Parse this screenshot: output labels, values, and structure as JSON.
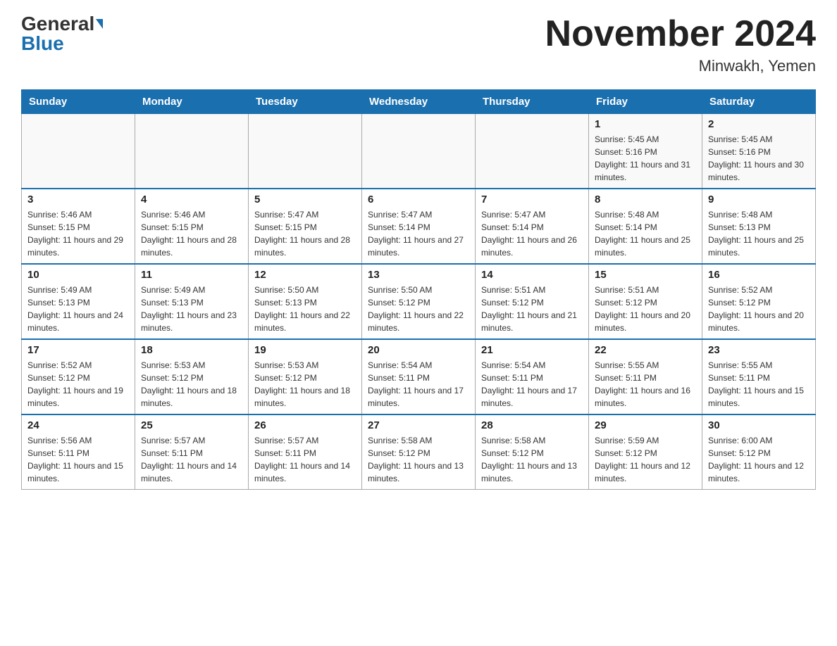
{
  "header": {
    "logo_general": "General",
    "logo_blue": "Blue",
    "month_title": "November 2024",
    "location": "Minwakh, Yemen"
  },
  "weekdays": [
    "Sunday",
    "Monday",
    "Tuesday",
    "Wednesday",
    "Thursday",
    "Friday",
    "Saturday"
  ],
  "weeks": [
    [
      {
        "day": "",
        "info": ""
      },
      {
        "day": "",
        "info": ""
      },
      {
        "day": "",
        "info": ""
      },
      {
        "day": "",
        "info": ""
      },
      {
        "day": "",
        "info": ""
      },
      {
        "day": "1",
        "info": "Sunrise: 5:45 AM\nSunset: 5:16 PM\nDaylight: 11 hours and 31 minutes."
      },
      {
        "day": "2",
        "info": "Sunrise: 5:45 AM\nSunset: 5:16 PM\nDaylight: 11 hours and 30 minutes."
      }
    ],
    [
      {
        "day": "3",
        "info": "Sunrise: 5:46 AM\nSunset: 5:15 PM\nDaylight: 11 hours and 29 minutes."
      },
      {
        "day": "4",
        "info": "Sunrise: 5:46 AM\nSunset: 5:15 PM\nDaylight: 11 hours and 28 minutes."
      },
      {
        "day": "5",
        "info": "Sunrise: 5:47 AM\nSunset: 5:15 PM\nDaylight: 11 hours and 28 minutes."
      },
      {
        "day": "6",
        "info": "Sunrise: 5:47 AM\nSunset: 5:14 PM\nDaylight: 11 hours and 27 minutes."
      },
      {
        "day": "7",
        "info": "Sunrise: 5:47 AM\nSunset: 5:14 PM\nDaylight: 11 hours and 26 minutes."
      },
      {
        "day": "8",
        "info": "Sunrise: 5:48 AM\nSunset: 5:14 PM\nDaylight: 11 hours and 25 minutes."
      },
      {
        "day": "9",
        "info": "Sunrise: 5:48 AM\nSunset: 5:13 PM\nDaylight: 11 hours and 25 minutes."
      }
    ],
    [
      {
        "day": "10",
        "info": "Sunrise: 5:49 AM\nSunset: 5:13 PM\nDaylight: 11 hours and 24 minutes."
      },
      {
        "day": "11",
        "info": "Sunrise: 5:49 AM\nSunset: 5:13 PM\nDaylight: 11 hours and 23 minutes."
      },
      {
        "day": "12",
        "info": "Sunrise: 5:50 AM\nSunset: 5:13 PM\nDaylight: 11 hours and 22 minutes."
      },
      {
        "day": "13",
        "info": "Sunrise: 5:50 AM\nSunset: 5:12 PM\nDaylight: 11 hours and 22 minutes."
      },
      {
        "day": "14",
        "info": "Sunrise: 5:51 AM\nSunset: 5:12 PM\nDaylight: 11 hours and 21 minutes."
      },
      {
        "day": "15",
        "info": "Sunrise: 5:51 AM\nSunset: 5:12 PM\nDaylight: 11 hours and 20 minutes."
      },
      {
        "day": "16",
        "info": "Sunrise: 5:52 AM\nSunset: 5:12 PM\nDaylight: 11 hours and 20 minutes."
      }
    ],
    [
      {
        "day": "17",
        "info": "Sunrise: 5:52 AM\nSunset: 5:12 PM\nDaylight: 11 hours and 19 minutes."
      },
      {
        "day": "18",
        "info": "Sunrise: 5:53 AM\nSunset: 5:12 PM\nDaylight: 11 hours and 18 minutes."
      },
      {
        "day": "19",
        "info": "Sunrise: 5:53 AM\nSunset: 5:12 PM\nDaylight: 11 hours and 18 minutes."
      },
      {
        "day": "20",
        "info": "Sunrise: 5:54 AM\nSunset: 5:11 PM\nDaylight: 11 hours and 17 minutes."
      },
      {
        "day": "21",
        "info": "Sunrise: 5:54 AM\nSunset: 5:11 PM\nDaylight: 11 hours and 17 minutes."
      },
      {
        "day": "22",
        "info": "Sunrise: 5:55 AM\nSunset: 5:11 PM\nDaylight: 11 hours and 16 minutes."
      },
      {
        "day": "23",
        "info": "Sunrise: 5:55 AM\nSunset: 5:11 PM\nDaylight: 11 hours and 15 minutes."
      }
    ],
    [
      {
        "day": "24",
        "info": "Sunrise: 5:56 AM\nSunset: 5:11 PM\nDaylight: 11 hours and 15 minutes."
      },
      {
        "day": "25",
        "info": "Sunrise: 5:57 AM\nSunset: 5:11 PM\nDaylight: 11 hours and 14 minutes."
      },
      {
        "day": "26",
        "info": "Sunrise: 5:57 AM\nSunset: 5:11 PM\nDaylight: 11 hours and 14 minutes."
      },
      {
        "day": "27",
        "info": "Sunrise: 5:58 AM\nSunset: 5:12 PM\nDaylight: 11 hours and 13 minutes."
      },
      {
        "day": "28",
        "info": "Sunrise: 5:58 AM\nSunset: 5:12 PM\nDaylight: 11 hours and 13 minutes."
      },
      {
        "day": "29",
        "info": "Sunrise: 5:59 AM\nSunset: 5:12 PM\nDaylight: 11 hours and 12 minutes."
      },
      {
        "day": "30",
        "info": "Sunrise: 6:00 AM\nSunset: 5:12 PM\nDaylight: 11 hours and 12 minutes."
      }
    ]
  ]
}
